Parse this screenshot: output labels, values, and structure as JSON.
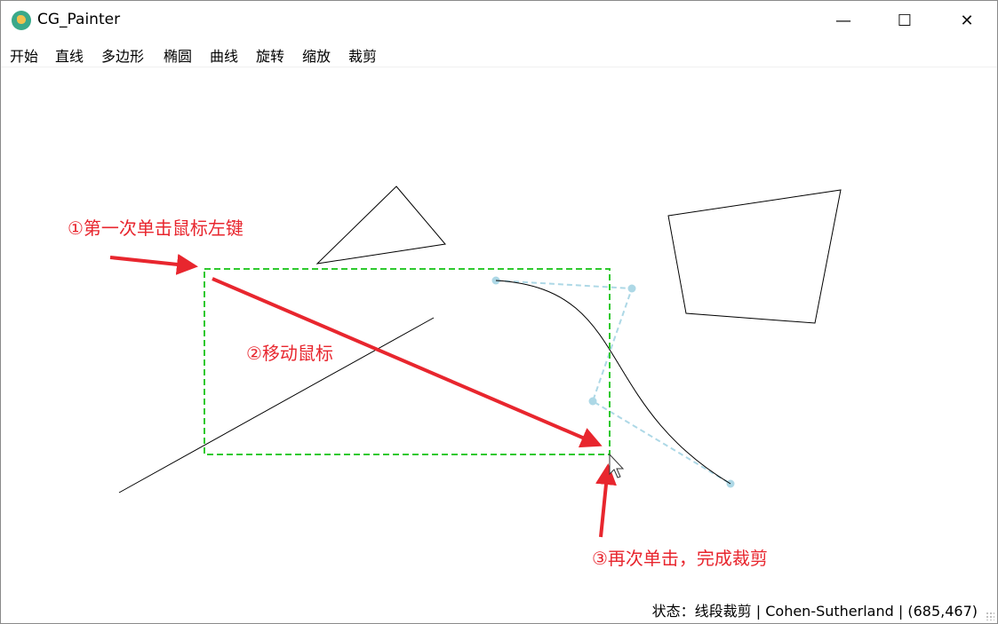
{
  "window": {
    "title": "CG_Painter",
    "minimize": "—",
    "maximize": "☐",
    "close": "✕"
  },
  "menu": [
    {
      "label": "开始"
    },
    {
      "label": "直线"
    },
    {
      "label": "多边形"
    },
    {
      "label": "椭圆"
    },
    {
      "label": "曲线"
    },
    {
      "label": "旋转"
    },
    {
      "label": "缩放"
    },
    {
      "label": "裁剪"
    }
  ],
  "annotations": {
    "step1": "①第一次单击鼠标左键",
    "step2": "②移动鼠标",
    "step3": "③再次单击，完成裁剪"
  },
  "status": "状态：线段裁剪 | Cohen-Sutherland | (685,467)",
  "colors": {
    "clip_rect": "#2ec92e",
    "control_polygon": "#add8e6",
    "annotation": "#e8262e",
    "shape_stroke": "#000000"
  }
}
